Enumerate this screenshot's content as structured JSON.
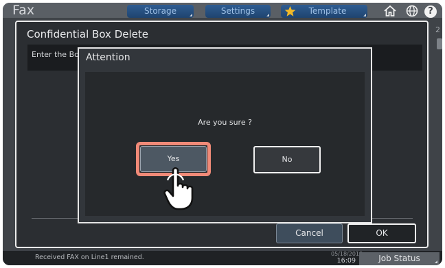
{
  "topbar": {
    "app_title": "Fax",
    "buttons": [
      "Storage",
      "Settings",
      "Template"
    ],
    "icons": [
      "star-icon",
      "home-icon",
      "globe-icon",
      "help-icon"
    ],
    "help_glyph": "?"
  },
  "outer_dialog": {
    "title": "Confidential Box Delete",
    "instruction": "Enter the Bo",
    "cancel_label": "Cancel",
    "ok_label": "OK",
    "side_glyph": "2"
  },
  "modal": {
    "title": "Attention",
    "message": "Are you sure ?",
    "yes_label": "Yes",
    "no_label": "No",
    "highlight_color": "#f08a78"
  },
  "statusbar": {
    "message": "Received FAX on Line1 remained.",
    "date": "05/18/2018",
    "time": "16:09",
    "job_status_label": "Job Status"
  }
}
